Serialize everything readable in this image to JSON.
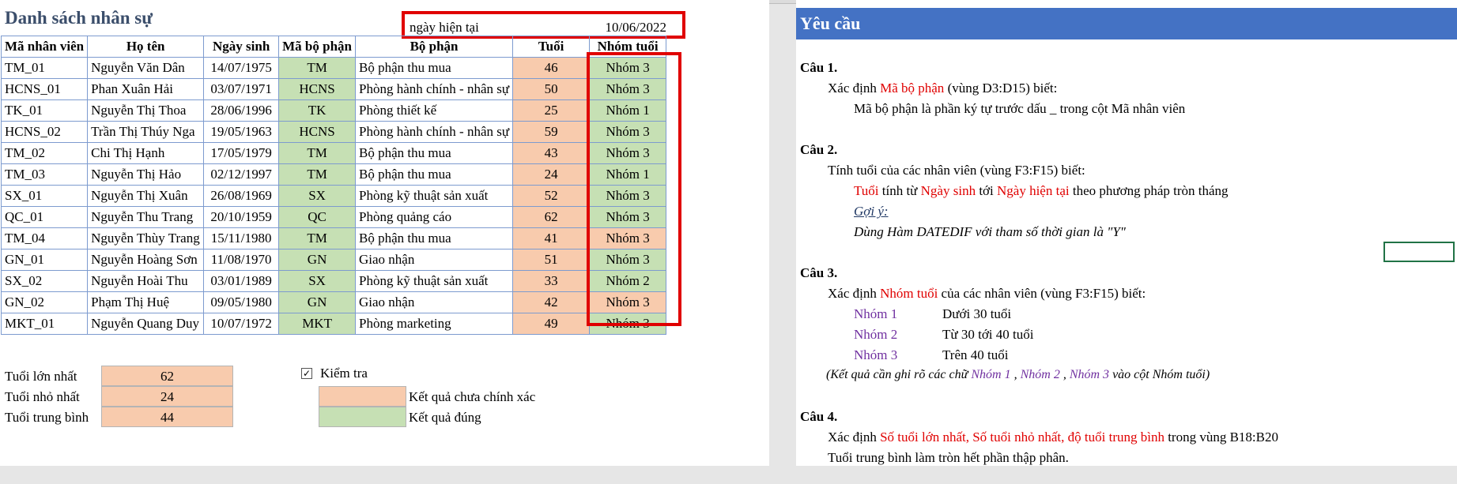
{
  "sheet": {
    "title": "Danh sách nhân sự",
    "current_date_label": "ngày hiện tại",
    "current_date_value": "10/06/2022",
    "headers": [
      "Mã nhân viên",
      "Họ tên",
      "Ngày sinh",
      "Mã bộ phận",
      "Bộ phận",
      "Tuổi",
      "Nhóm tuổi"
    ],
    "rows": [
      [
        "TM_01",
        "Nguyễn Văn Dân",
        "14/07/1975",
        "TM",
        "Bộ phận thu mua",
        "46",
        "Nhóm 3"
      ],
      [
        "HCNS_01",
        "Phan Xuân Hải",
        "03/07/1971",
        "HCNS",
        "Phòng hành chính - nhân sự",
        "50",
        "Nhóm 3"
      ],
      [
        "TK_01",
        "Nguyễn Thị Thoa",
        "28/06/1996",
        "TK",
        "Phòng thiết kế",
        "25",
        "Nhóm 1"
      ],
      [
        "HCNS_02",
        "Trần Thị Thúy Nga",
        "19/05/1963",
        "HCNS",
        "Phòng hành chính - nhân sự",
        "59",
        "Nhóm 3"
      ],
      [
        "TM_02",
        "Chi Thị Hạnh",
        "17/05/1979",
        "TM",
        "Bộ phận thu mua",
        "43",
        "Nhóm 3"
      ],
      [
        "TM_03",
        "Nguyễn Thị Hảo",
        "02/12/1997",
        "TM",
        "Bộ phận thu mua",
        "24",
        "Nhóm 1"
      ],
      [
        "SX_01",
        "Nguyễn Thị  Xuân",
        "26/08/1969",
        "SX",
        "Phòng kỹ thuật sản xuất",
        "52",
        "Nhóm 3"
      ],
      [
        "QC_01",
        "Nguyễn Thu Trang",
        "20/10/1959",
        "QC",
        "Phòng quảng cáo",
        "62",
        "Nhóm 3"
      ],
      [
        "TM_04",
        "Nguyễn Thùy Trang",
        "15/11/1980",
        "TM",
        "Bộ phận thu mua",
        "41",
        "Nhóm 3"
      ],
      [
        "GN_01",
        "Nguyễn Hoàng Sơn",
        "11/08/1970",
        "GN",
        "Giao nhận",
        "51",
        "Nhóm 3"
      ],
      [
        "SX_02",
        "Nguyễn Hoài Thu",
        "03/01/1989",
        "SX",
        "Phòng kỹ thuật sản xuất",
        "33",
        "Nhóm 2"
      ],
      [
        "GN_02",
        "Phạm Thị Huệ",
        "09/05/1980",
        "GN",
        "Giao nhận",
        "42",
        "Nhóm 3"
      ],
      [
        "MKT_01",
        "Nguyễn Quang Duy",
        "10/07/1972",
        "MKT",
        "Phòng marketing",
        "49",
        "Nhóm 3"
      ]
    ],
    "group_cell_status": [
      "ok",
      "ok",
      "ok",
      "ok",
      "ok",
      "ok",
      "ok",
      "ok",
      "wrong",
      "ok",
      "ok",
      "wrong",
      "ok"
    ],
    "summary": {
      "max_label": "Tuổi lớn nhất",
      "max_value": "62",
      "min_label": "Tuổi nhỏ nhất",
      "min_value": "24",
      "avg_label": "Tuổi trung bình",
      "avg_value": "44"
    },
    "check": {
      "checked": true,
      "label": "Kiểm tra",
      "wrong_label": "Kết quả chưa chính xác",
      "right_label": "Kết quả đúng"
    },
    "colors": {
      "correct": "#c6e0b4",
      "wrong": "#f8cbad",
      "header": "#4472c4",
      "highlight": "#e00000"
    }
  },
  "panel": {
    "title": "Yêu cầu",
    "q1": {
      "heading": "Câu 1.",
      "line1_a": "Xác định ",
      "line1_red": "Mã bộ phận",
      "line1_b": " (vùng D3:D15) biết:",
      "line2": "Mã bộ phận là phần ký tự trước dấu _ trong cột Mã nhân viên"
    },
    "q2": {
      "heading": "Câu 2.",
      "line1": "Tính tuổi của các nhân viên (vùng F3:F15) biết:",
      "l2_red1": "Tuổi",
      "l2_a": " tính từ ",
      "l2_red2": "Ngày sinh",
      "l2_b": " tới ",
      "l2_red3": "Ngày hiện tại",
      "l2_c": " theo phương pháp tròn tháng",
      "hint": "Gợi ý:",
      "hint_text": "Dùng Hàm DATEDIF với tham số thời gian là \"Y\""
    },
    "q3": {
      "heading": "Câu 3.",
      "line1_a": "Xác định ",
      "line1_red": "Nhóm tuổi",
      "line1_b": " của các nhân viên (vùng F3:F15) biết:",
      "groups": [
        {
          "name": "Nhóm 1",
          "desc": "Dưới 30 tuổi"
        },
        {
          "name": "Nhóm 2",
          "desc": "Từ 30 tới 40 tuổi"
        },
        {
          "name": "Nhóm 3",
          "desc": "Trên 40 tuổi"
        }
      ],
      "note_a": "(Kết quả cần ghi rõ các chữ ",
      "note_g1": "Nhóm 1",
      "note_sep1": " , ",
      "note_g2": "Nhóm 2",
      "note_sep2": " , ",
      "note_g3": "Nhóm 3",
      "note_b": "  vào cột Nhóm tuổi)"
    },
    "q4": {
      "heading": "Câu 4.",
      "line1_a": "Xác định ",
      "line1_red": "Số tuổi lớn nhất, Số tuổi nhỏ nhất, độ tuổi trung bình",
      "line1_b": " trong vùng B18:B20",
      "line2": "Tuổi trung bình làm tròn hết phần thập phân."
    }
  }
}
